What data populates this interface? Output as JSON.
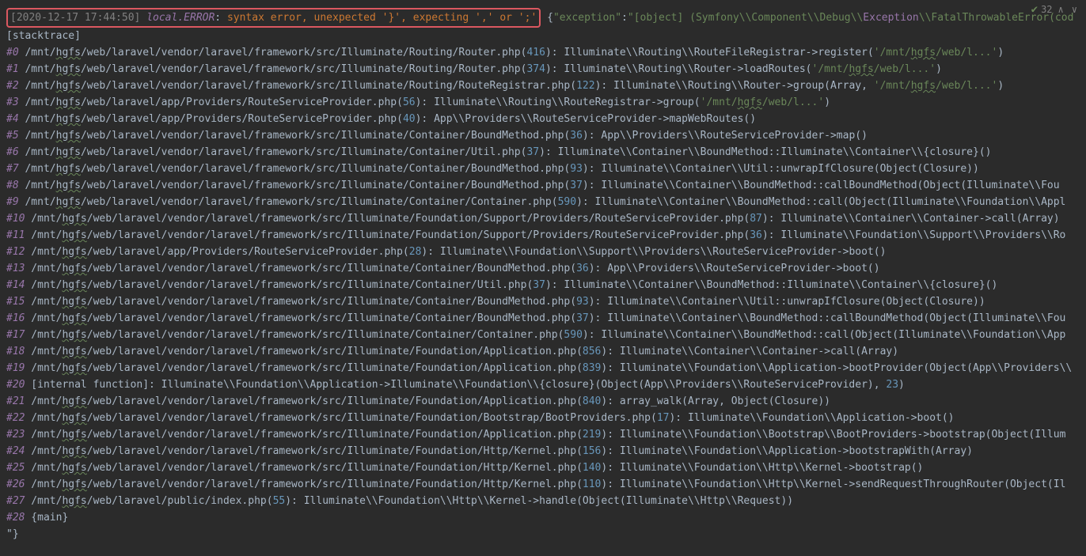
{
  "toolbar": {
    "count": "32"
  },
  "header": {
    "timestamp": "[2020-12-17 17:44:50]",
    "level": "local.ERROR",
    "colon": ": ",
    "msg": "syntax error, unexpected '}', expecting ',' or ';'",
    "after": " {",
    "exception_key": "\"exception\"",
    "after2": ":",
    "obj": "\"[object] (Symfony\\\\Component\\\\Debug\\\\",
    "exc_word": "Exception",
    "tail": "\\\\FatalThrowableError(cod"
  },
  "stacktrace_label": "[stacktrace]",
  "lines": [
    {
      "idx": "#0",
      "path": " /mnt/hgfs/web/laravel/vendor/laravel/framework/src/Illuminate/Routing/Router.php(",
      "ln": "416",
      "mid": "): Illuminate\\\\Routing\\\\RouteFileRegistrar->register(",
      "str": "'/mnt/hgfs/web/l...'",
      "end": ")"
    },
    {
      "idx": "#1",
      "path": " /mnt/hgfs/web/laravel/vendor/laravel/framework/src/Illuminate/Routing/Router.php(",
      "ln": "374",
      "mid": "): Illuminate\\\\Routing\\\\Router->loadRoutes(",
      "str": "'/mnt/hgfs/web/l...'",
      "end": ")"
    },
    {
      "idx": "#2",
      "path": " /mnt/hgfs/web/laravel/vendor/laravel/framework/src/Illuminate/Routing/RouteRegistrar.php(",
      "ln": "122",
      "mid": "): Illuminate\\\\Routing\\\\Router->group(Array, ",
      "str": "'/mnt/hgfs/web/l...'",
      "end": ")"
    },
    {
      "idx": "#3",
      "path": " /mnt/hgfs/web/laravel/app/Providers/RouteServiceProvider.php(",
      "ln": "56",
      "mid": "): Illuminate\\\\Routing\\\\RouteRegistrar->group(",
      "str": "'/mnt/hgfs/web/l...'",
      "end": ")"
    },
    {
      "idx": "#4",
      "path": " /mnt/hgfs/web/laravel/app/Providers/RouteServiceProvider.php(",
      "ln": "40",
      "mid": "): App\\\\Providers\\\\RouteServiceProvider->mapWebRoutes()",
      "str": "",
      "end": ""
    },
    {
      "idx": "#5",
      "path": " /mnt/hgfs/web/laravel/vendor/laravel/framework/src/Illuminate/Container/BoundMethod.php(",
      "ln": "36",
      "mid": "): App\\\\Providers\\\\RouteServiceProvider->map()",
      "str": "",
      "end": ""
    },
    {
      "idx": "#6",
      "path": " /mnt/hgfs/web/laravel/vendor/laravel/framework/src/Illuminate/Container/Util.php(",
      "ln": "37",
      "mid": "): Illuminate\\\\Container\\\\BoundMethod::Illuminate\\\\Container\\\\{closure}()",
      "str": "",
      "end": ""
    },
    {
      "idx": "#7",
      "path": " /mnt/hgfs/web/laravel/vendor/laravel/framework/src/Illuminate/Container/BoundMethod.php(",
      "ln": "93",
      "mid": "): Illuminate\\\\Container\\\\Util::unwrapIfClosure(Object(Closure))",
      "str": "",
      "end": ""
    },
    {
      "idx": "#8",
      "path": " /mnt/hgfs/web/laravel/vendor/laravel/framework/src/Illuminate/Container/BoundMethod.php(",
      "ln": "37",
      "mid": "): Illuminate\\\\Container\\\\BoundMethod::callBoundMethod(Object(Illuminate\\\\Fou",
      "str": "",
      "end": ""
    },
    {
      "idx": "#9",
      "path": " /mnt/hgfs/web/laravel/vendor/laravel/framework/src/Illuminate/Container/Container.php(",
      "ln": "590",
      "mid": "): Illuminate\\\\Container\\\\BoundMethod::call(Object(Illuminate\\\\Foundation\\\\Appl",
      "str": "",
      "end": ""
    },
    {
      "idx": "#10",
      "path": " /mnt/hgfs/web/laravel/vendor/laravel/framework/src/Illuminate/Foundation/Support/Providers/RouteServiceProvider.php(",
      "ln": "87",
      "mid": "): Illuminate\\\\Container\\\\Container->call(Array)",
      "str": "",
      "end": ""
    },
    {
      "idx": "#11",
      "path": " /mnt/hgfs/web/laravel/vendor/laravel/framework/src/Illuminate/Foundation/Support/Providers/RouteServiceProvider.php(",
      "ln": "36",
      "mid": "): Illuminate\\\\Foundation\\\\Support\\\\Providers\\\\Ro",
      "str": "",
      "end": ""
    },
    {
      "idx": "#12",
      "path": " /mnt/hgfs/web/laravel/app/Providers/RouteServiceProvider.php(",
      "ln": "28",
      "mid": "): Illuminate\\\\Foundation\\\\Support\\\\Providers\\\\RouteServiceProvider->boot()",
      "str": "",
      "end": ""
    },
    {
      "idx": "#13",
      "path": " /mnt/hgfs/web/laravel/vendor/laravel/framework/src/Illuminate/Container/BoundMethod.php(",
      "ln": "36",
      "mid": "): App\\\\Providers\\\\RouteServiceProvider->boot()",
      "str": "",
      "end": ""
    },
    {
      "idx": "#14",
      "path": " /mnt/hgfs/web/laravel/vendor/laravel/framework/src/Illuminate/Container/Util.php(",
      "ln": "37",
      "mid": "): Illuminate\\\\Container\\\\BoundMethod::Illuminate\\\\Container\\\\{closure}()",
      "str": "",
      "end": ""
    },
    {
      "idx": "#15",
      "path": " /mnt/hgfs/web/laravel/vendor/laravel/framework/src/Illuminate/Container/BoundMethod.php(",
      "ln": "93",
      "mid": "): Illuminate\\\\Container\\\\Util::unwrapIfClosure(Object(Closure))",
      "str": "",
      "end": ""
    },
    {
      "idx": "#16",
      "path": " /mnt/hgfs/web/laravel/vendor/laravel/framework/src/Illuminate/Container/BoundMethod.php(",
      "ln": "37",
      "mid": "): Illuminate\\\\Container\\\\BoundMethod::callBoundMethod(Object(Illuminate\\\\Fou",
      "str": "",
      "end": ""
    },
    {
      "idx": "#17",
      "path": " /mnt/hgfs/web/laravel/vendor/laravel/framework/src/Illuminate/Container/Container.php(",
      "ln": "590",
      "mid": "): Illuminate\\\\Container\\\\BoundMethod::call(Object(Illuminate\\\\Foundation\\\\App",
      "str": "",
      "end": ""
    },
    {
      "idx": "#18",
      "path": " /mnt/hgfs/web/laravel/vendor/laravel/framework/src/Illuminate/Foundation/Application.php(",
      "ln": "856",
      "mid": "): Illuminate\\\\Container\\\\Container->call(Array)",
      "str": "",
      "end": ""
    },
    {
      "idx": "#19",
      "path": " /mnt/hgfs/web/laravel/vendor/laravel/framework/src/Illuminate/Foundation/Application.php(",
      "ln": "839",
      "mid": "): Illuminate\\\\Foundation\\\\Application->bootProvider(Object(App\\\\Providers\\\\",
      "str": "",
      "end": ""
    },
    {
      "idx": "#20",
      "path": " [internal function]: Illuminate\\\\Foundation\\\\Application->Illuminate\\\\Foundation\\\\{closure}(Object(App\\\\Providers\\\\RouteServiceProvider), ",
      "ln": "23",
      "mid": ")",
      "str": "",
      "end": "",
      "noLineParen": true
    },
    {
      "idx": "#21",
      "path": " /mnt/hgfs/web/laravel/vendor/laravel/framework/src/Illuminate/Foundation/Application.php(",
      "ln": "840",
      "mid": "): array_walk(Array, Object(Closure))",
      "str": "",
      "end": ""
    },
    {
      "idx": "#22",
      "path": " /mnt/hgfs/web/laravel/vendor/laravel/framework/src/Illuminate/Foundation/Bootstrap/BootProviders.php(",
      "ln": "17",
      "mid": "): Illuminate\\\\Foundation\\\\Application->boot()",
      "str": "",
      "end": ""
    },
    {
      "idx": "#23",
      "path": " /mnt/hgfs/web/laravel/vendor/laravel/framework/src/Illuminate/Foundation/Application.php(",
      "ln": "219",
      "mid": "): Illuminate\\\\Foundation\\\\Bootstrap\\\\BootProviders->bootstrap(Object(Illum",
      "str": "",
      "end": ""
    },
    {
      "idx": "#24",
      "path": " /mnt/hgfs/web/laravel/vendor/laravel/framework/src/Illuminate/Foundation/Http/Kernel.php(",
      "ln": "156",
      "mid": "): Illuminate\\\\Foundation\\\\Application->bootstrapWith(Array)",
      "str": "",
      "end": ""
    },
    {
      "idx": "#25",
      "path": " /mnt/hgfs/web/laravel/vendor/laravel/framework/src/Illuminate/Foundation/Http/Kernel.php(",
      "ln": "140",
      "mid": "): Illuminate\\\\Foundation\\\\Http\\\\Kernel->bootstrap()",
      "str": "",
      "end": ""
    },
    {
      "idx": "#26",
      "path": " /mnt/hgfs/web/laravel/vendor/laravel/framework/src/Illuminate/Foundation/Http/Kernel.php(",
      "ln": "110",
      "mid": "): Illuminate\\\\Foundation\\\\Http\\\\Kernel->sendRequestThroughRouter(Object(Il",
      "str": "",
      "end": ""
    },
    {
      "idx": "#27",
      "path": " /mnt/hgfs/web/laravel/public/index.php(",
      "ln": "55",
      "mid": "): Illuminate\\\\Foundation\\\\Http\\\\Kernel->handle(Object(Illuminate\\\\Http\\\\Request))",
      "str": "",
      "end": ""
    },
    {
      "idx": "#28",
      "path": " {main}",
      "ln": "",
      "mid": "",
      "str": "",
      "end": "",
      "plain": true
    }
  ],
  "footer": "\"} "
}
